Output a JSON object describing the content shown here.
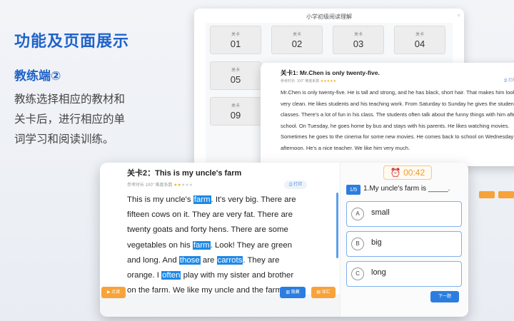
{
  "hero": {
    "title": "功能及页面展示",
    "section": "教练端②",
    "description": "教练选择相应的教材和关卡后，进行相应的单词学习和阅读训练。"
  },
  "level_window": {
    "title": "小学初级阅读理解",
    "levels": [
      {
        "label": "关卡",
        "number": "01"
      },
      {
        "label": "关卡",
        "number": "02"
      },
      {
        "label": "关卡",
        "number": "03"
      },
      {
        "label": "关卡",
        "number": "04"
      },
      {
        "label": "关卡",
        "number": "05"
      },
      {
        "label": "关卡",
        "number": "09"
      }
    ]
  },
  "passage_window": {
    "title": "关卡1: Mr.Chen is only twenty-five.",
    "meta": "参考时长: 100\" 难度系数",
    "stars": "★★★★★",
    "print_label": "打印",
    "text": "Mr.Chen is only twenty-five. He is tall and strong, and he has black, short hair. That makes him look very clean. He likes students and his teaching work. From Saturday to Sunday he gives the students classes. There's a lot of fun in his class. The students often talk about the funny things with him after school. On Tuesday, he goes home by bus and stays with his parents. He likes watching movies. Sometimes he goes to the cinema for some new movies. He comes back to school on Wednesday afternoon. He's a nice teacher. We like him very much."
  },
  "main_window": {
    "title": "关卡2：This is my uncle's farm",
    "meta": "参考时长 100\" 难度系数",
    "stars": "★★",
    "stars_empty": "★★★",
    "print_label": "打印",
    "passage": {
      "s1": "This is my uncle's ",
      "h1": "farm",
      "s2": ".  It's very big. There are fifteen cows on it. They are very fat. There are twenty goats and forty hens. There are some vegetables on his ",
      "h2": "farm",
      "s3": ". Look! They are green and long. And ",
      "h3": "those",
      "s4": " are ",
      "h4": "carrots",
      "s5": ". They are orange. I ",
      "h5": "often",
      "s6": " play with my sister and brother on the farm. We like my uncle and the farm."
    },
    "footer": {
      "left_button": "点读",
      "middle_button": "隐藏",
      "right_button": "译汇"
    },
    "quiz": {
      "timer": "00:42",
      "index": "1/5",
      "question": "1.My uncle's farm is _____.",
      "options": [
        {
          "letter": "A",
          "text": "small"
        },
        {
          "letter": "B",
          "text": "big"
        },
        {
          "letter": "C",
          "text": "long"
        }
      ],
      "next_label": "下一题"
    }
  }
}
